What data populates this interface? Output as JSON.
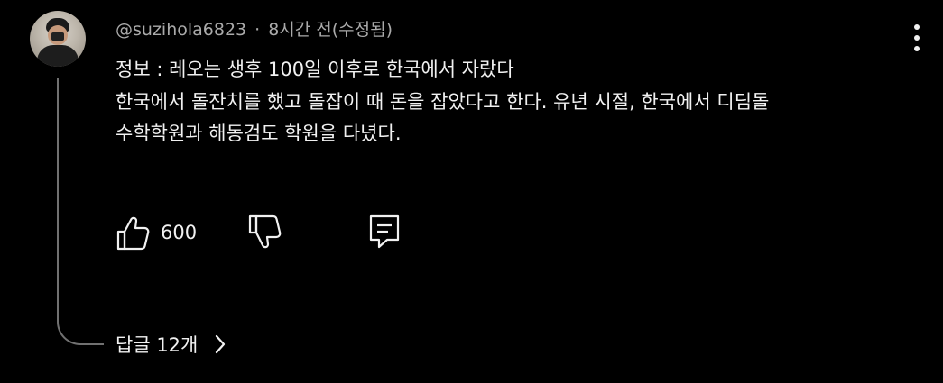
{
  "comment": {
    "author": "@suzihola6823",
    "separator": "·",
    "timestamp": "8시간 전(수정됨)",
    "lines": [
      "정보 : 레오는 생후 100일 이후로 한국에서 자랐다",
      "한국에서 돌잔치를 했고 돌잡이 때 돈을 잡았다고 한다. 유년 시절, 한국에서 디딤돌",
      "수학학원과 해동검도 학원을 다녔다."
    ],
    "like_count": "600",
    "replies_label": "답글 12개"
  },
  "icons": {
    "menu": "more-vertical-icon",
    "like": "thumbs-up-icon",
    "dislike": "thumbs-down-icon",
    "reply": "comment-icon",
    "expand": "chevron-right-icon"
  },
  "colors": {
    "background": "#000000",
    "text": "#f1f1f1",
    "meta": "#aaaaaa",
    "thread_line": "#717171"
  }
}
